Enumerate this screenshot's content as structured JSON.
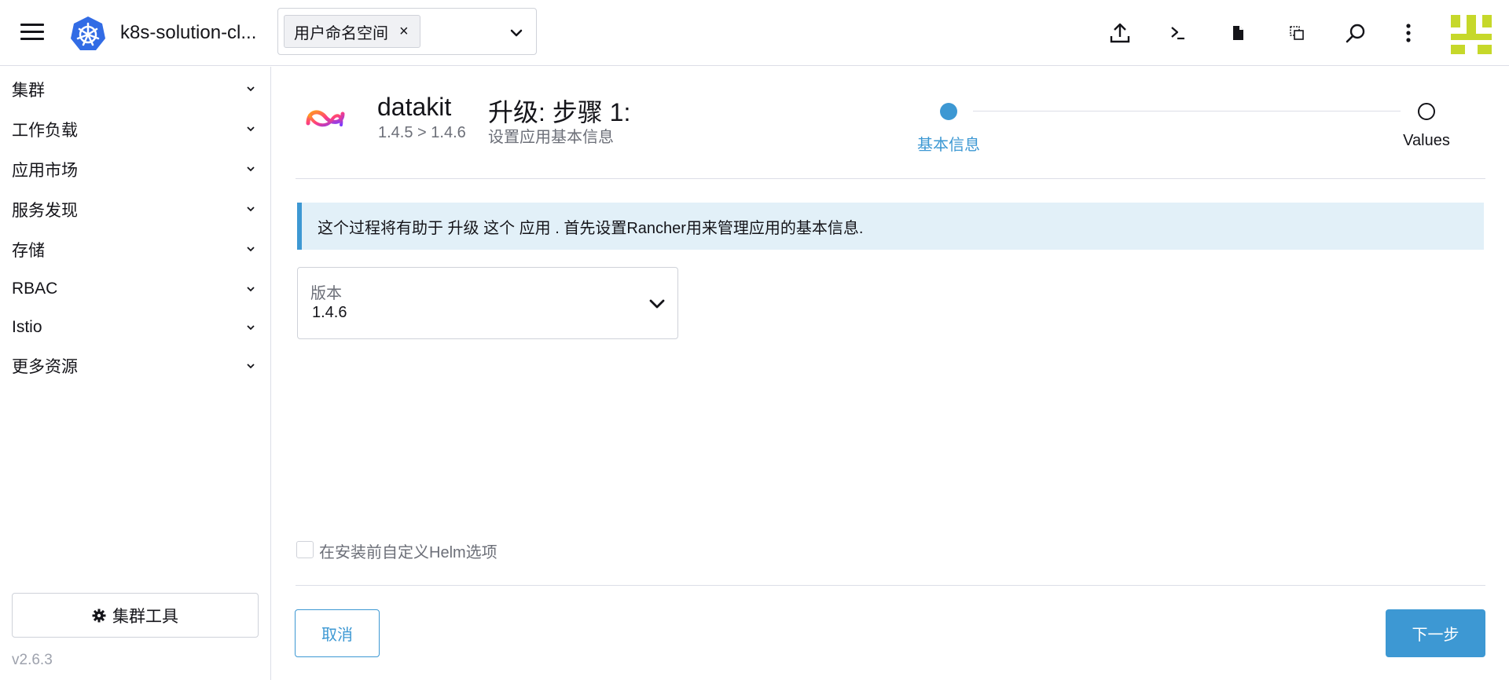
{
  "header": {
    "cluster_name": "k8s-solution-cl...",
    "namespace_chip": "用户命名空间",
    "namespace_chip_remove": "×",
    "icons": [
      "menu-icon",
      "kubernetes-logo-icon",
      "upload-icon",
      "terminal-icon",
      "file-icon",
      "copy-config-icon",
      "search-icon",
      "more-vertical-icon",
      "user-avatar-icon"
    ]
  },
  "sidebar": {
    "items": [
      {
        "label": "集群"
      },
      {
        "label": "工作负载"
      },
      {
        "label": "应用市场"
      },
      {
        "label": "服务发现"
      },
      {
        "label": "存储"
      },
      {
        "label": "RBAC"
      },
      {
        "label": "Istio"
      },
      {
        "label": "更多资源"
      }
    ],
    "tools_label": "集群工具",
    "version": "v2.6.3"
  },
  "main": {
    "app_name": "datakit",
    "app_version": "1.4.5 > 1.4.6",
    "step_title": "升级: 步骤 1:",
    "step_subtitle": "设置应用基本信息",
    "steps": [
      {
        "label": "基本信息",
        "active": true
      },
      {
        "label": "Values",
        "active": false
      }
    ],
    "info_banner": "这个过程将有助于 升级 这个 应用 . 首先设置Rancher用来管理应用的基本信息.",
    "version_field": {
      "label": "版本",
      "value": "1.4.6"
    },
    "helm_checkbox_label": "在安装前自定义Helm选项",
    "helm_checkbox_checked": false,
    "cancel_label": "取消",
    "next_label": "下一步"
  },
  "colors": {
    "accent": "#3d98d3",
    "banner_bg": "#e2f0f8",
    "border": "#dcdee7",
    "avatar_green": "#c6d82a"
  }
}
